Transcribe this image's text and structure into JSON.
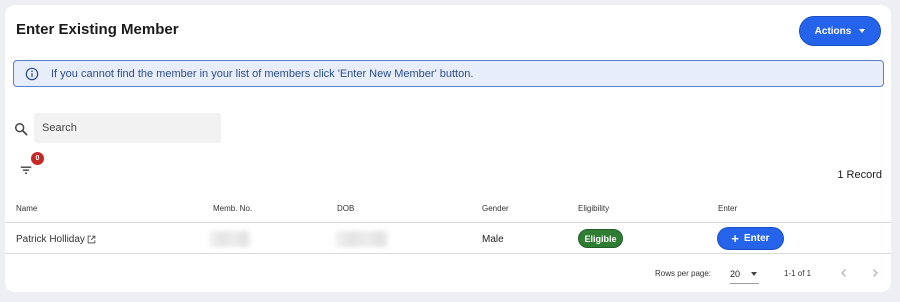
{
  "header": {
    "title": "Enter Existing Member",
    "actions_label": "Actions"
  },
  "info": {
    "message": "If you cannot find the member in your list of members click 'Enter New Member' button.",
    "icon": "info-icon"
  },
  "search": {
    "placeholder": "Search",
    "value": ""
  },
  "filter": {
    "badge_count": "0"
  },
  "records": {
    "count_label": "1 Record"
  },
  "table": {
    "columns": [
      "Name",
      "Memb. No.",
      "DOB",
      "Gender",
      "Eligibility",
      "Enter"
    ],
    "rows": [
      {
        "name": "Patrick Holliday",
        "memb_no": "",
        "dob": "",
        "gender": "Male",
        "eligibility": "Eligible",
        "enter_label": "Enter"
      }
    ]
  },
  "pagination": {
    "rows_per_page_label": "Rows per page:",
    "rows_per_page_value": "20",
    "range": "1-1 of 1"
  },
  "colors": {
    "primary": "#2563eb",
    "eligible": "#2e7d32",
    "badge": "#c62828",
    "info_border": "#5b7fcf",
    "info_bg": "#e8eef9"
  }
}
